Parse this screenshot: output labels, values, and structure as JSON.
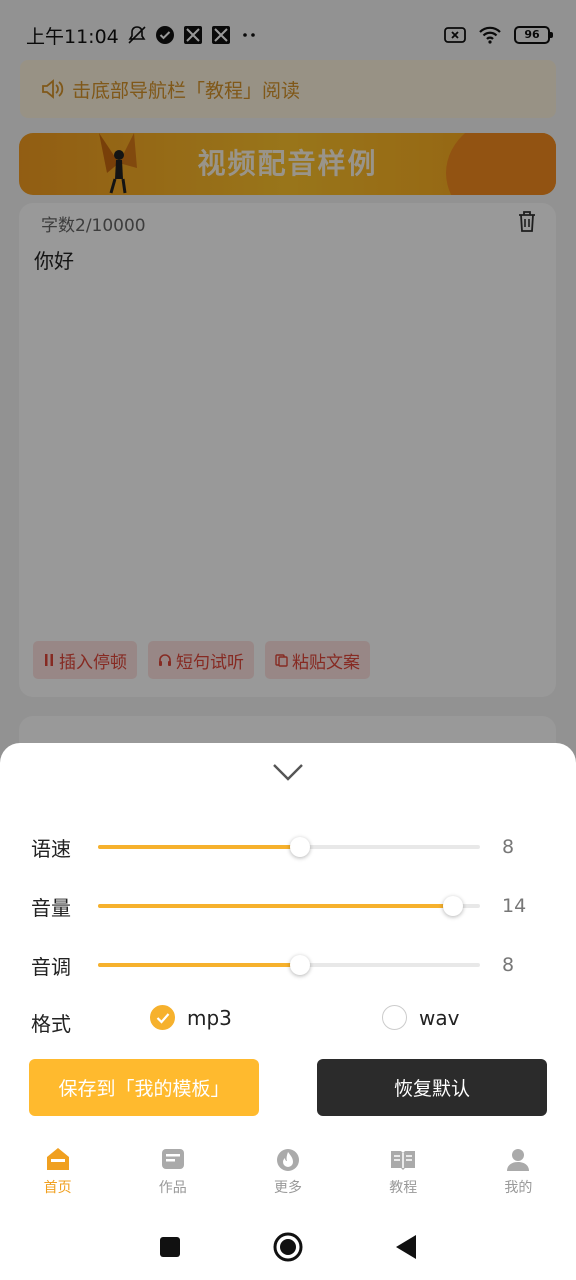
{
  "status_bar": {
    "time": "上午11:04",
    "battery": "96"
  },
  "notice": {
    "text": "击底部导航栏「教程」阅读"
  },
  "banner": {
    "title": "视频配音样例"
  },
  "editor": {
    "char_count": "字数2/10000",
    "content": "你好",
    "actions": [
      {
        "label": "插入停顿"
      },
      {
        "label": "短句试听"
      },
      {
        "label": "粘贴文案"
      }
    ]
  },
  "sheet": {
    "sliders": [
      {
        "label": "语速",
        "value": "8",
        "level": 0.53
      },
      {
        "label": "音量",
        "value": "14",
        "level": 0.93
      },
      {
        "label": "音调",
        "value": "8",
        "level": 0.53
      }
    ],
    "format": {
      "label": "格式",
      "options": [
        {
          "label": "mp3",
          "selected": true
        },
        {
          "label": "wav",
          "selected": false
        }
      ]
    },
    "save_button": "保存到「我的模板」",
    "reset_button": "恢复默认"
  },
  "tabbar": {
    "tabs": [
      {
        "label": "首页",
        "active": true
      },
      {
        "label": "作品",
        "active": false
      },
      {
        "label": "更多",
        "active": false
      },
      {
        "label": "教程",
        "active": false
      },
      {
        "label": "我的",
        "active": false
      }
    ]
  },
  "colors": {
    "accent": "#f6b12d",
    "tab_active": "#f0a020",
    "chip_text": "#e0463a",
    "dark_button": "#2b2b2b"
  }
}
